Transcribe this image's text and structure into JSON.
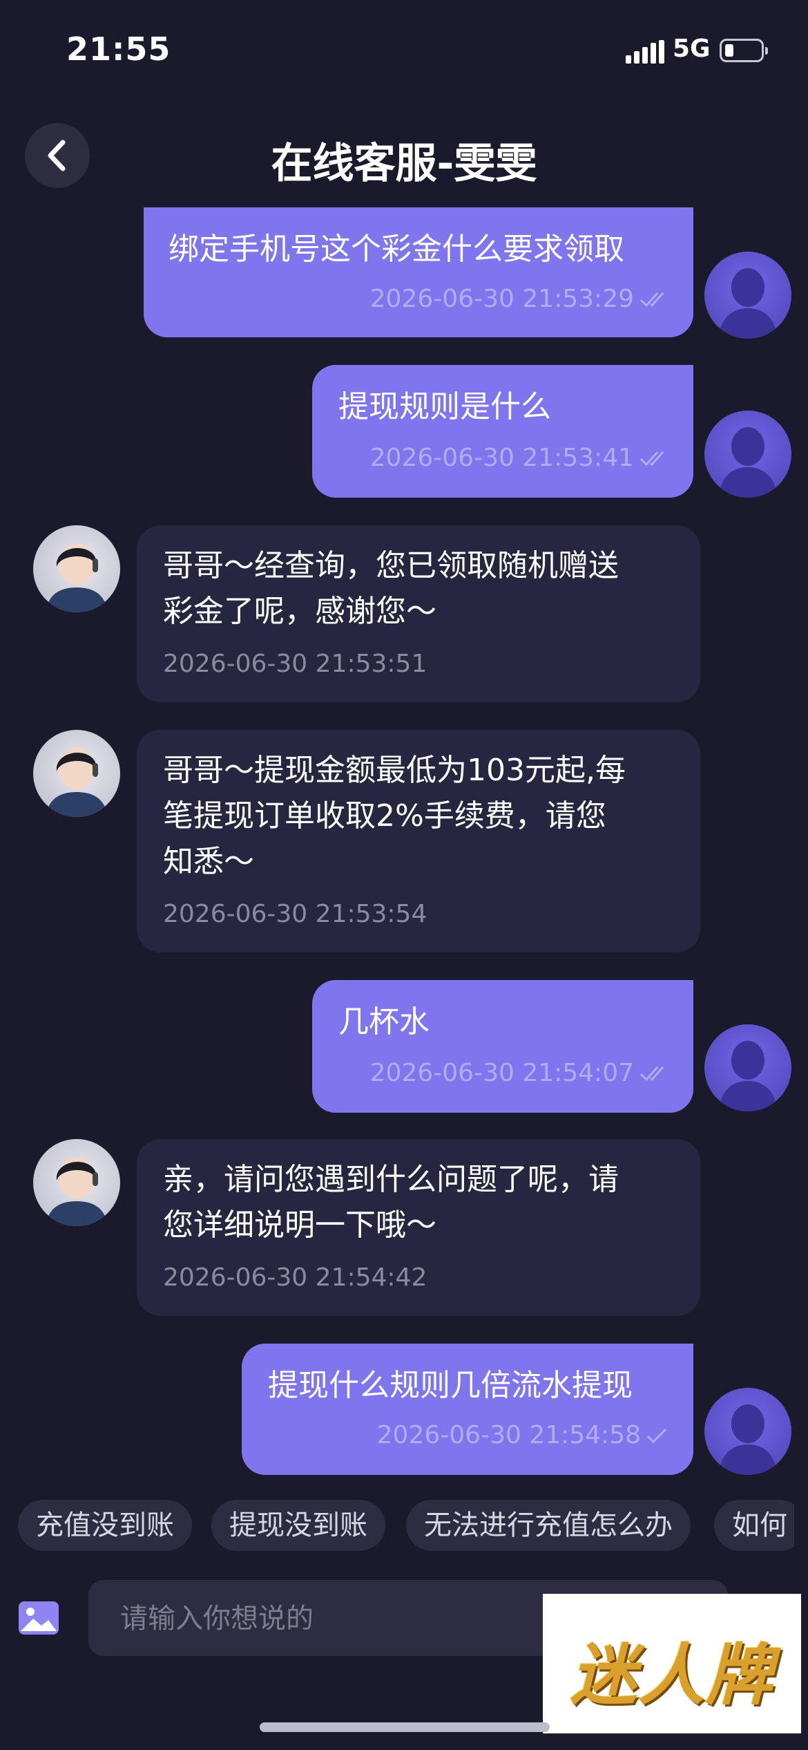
{
  "status_bar": {
    "time": "21:55",
    "network": "5G"
  },
  "header": {
    "title": "在线客服-雯雯"
  },
  "messages": [
    {
      "side": "out",
      "text": "绑定手机号这个彩金什么要求领取",
      "time": "2026-06-30 21:53:29"
    },
    {
      "side": "out",
      "text": "提现规则是什么",
      "time": "2026-06-30 21:53:41"
    },
    {
      "side": "in",
      "lines": [
        "哥哥～经查询，您已领取随机赠送",
        "彩金了呢，感谢您～"
      ],
      "time": "2026-06-30 21:53:51"
    },
    {
      "side": "in",
      "lines": [
        "哥哥～提现金额最低为103元起,每",
        "笔提现订单收取2%手续费，请您",
        "知悉～"
      ],
      "time": "2026-06-30 21:53:54"
    },
    {
      "side": "out",
      "text": "几杯水",
      "time": "2026-06-30 21:54:07"
    },
    {
      "side": "in",
      "lines": [
        "亲，请问您遇到什么问题了呢，请",
        "您详细说明一下哦～"
      ],
      "time": "2026-06-30 21:54:42"
    },
    {
      "side": "out",
      "text": "提现什么规则几倍流水提现",
      "time": "2026-06-30 21:54:58"
    }
  ],
  "quick_replies": [
    "充值没到账",
    "提现没到账",
    "无法进行充值怎么办",
    "如何"
  ],
  "input": {
    "placeholder": "请输入你想说的"
  },
  "watermark": {
    "text": "迷人牌"
  },
  "colors": {
    "background": "#1b1a2c",
    "outgoing_bubble": "#7f76ee",
    "incoming_bubble": "#272641",
    "chip": "#2d2c42"
  },
  "icons": {
    "back": "chevron-left-icon",
    "read_receipt": "double-check-icon",
    "sent_receipt": "single-check-icon",
    "image": "image-icon"
  }
}
